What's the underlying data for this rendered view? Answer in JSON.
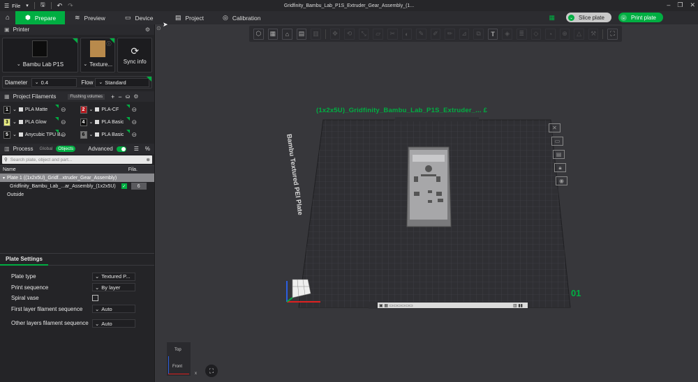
{
  "titlebar": {
    "file_menu": "File",
    "title": "Gridfinity_Bambu_Lab_P1S_Extruder_Gear_Assembly_(1..."
  },
  "tabs": [
    {
      "label": "Prepare",
      "icon": "cube-icon"
    },
    {
      "label": "Preview",
      "icon": "layers-icon"
    },
    {
      "label": "Device",
      "icon": "device-icon"
    },
    {
      "label": "Project",
      "icon": "project-icon"
    },
    {
      "label": "Calibration",
      "icon": "calibration-icon"
    }
  ],
  "actions": {
    "slice": "Slice plate",
    "print": "Print plate"
  },
  "printer": {
    "header": "Printer",
    "model": "Bambu Lab P1S",
    "plate": "Texture...",
    "sync": "Sync info",
    "diameter_label": "Diameter",
    "diameter_value": "0.4",
    "flow_label": "Flow",
    "flow_value": "Standard"
  },
  "filaments": {
    "header": "Project Filaments",
    "flushing": "Flushing volumes",
    "items": [
      {
        "num": "1",
        "name": "PLA Matte",
        "color": "#111111",
        "text_color": "#ffffff"
      },
      {
        "num": "2",
        "name": "PLA-CF",
        "color": "#b5191f",
        "text_color": "#ffffff"
      },
      {
        "num": "3",
        "name": "PLA Glow",
        "color": "#e9ed80",
        "text_color": "#000000"
      },
      {
        "num": "4",
        "name": "PLA Basic",
        "color": "#111111",
        "text_color": "#ffffff"
      },
      {
        "num": "5",
        "name": "Anycubic TPU B...",
        "color": "#111111",
        "text_color": "#ffffff"
      },
      {
        "num": "6",
        "name": "PLA Basic",
        "color": "#7a7a7a",
        "text_color": "#000000"
      }
    ]
  },
  "process": {
    "header": "Process",
    "global": "Global",
    "objects": "Objects",
    "advanced": "Advanced",
    "search_placeholder": "Search plate, object and part...",
    "col_name": "Name",
    "col_fila": "Fila.",
    "plate_row": "Plate 1 ((1x2x5U)_Gridf...xtruder_Gear_Assembly)",
    "object_row": "Gridfinity_Bambu_Lab_...ar_Assembly_(1x2x5U)",
    "object_fila": "6",
    "outside_row": "Outside"
  },
  "plate_settings": {
    "tab": "Plate Settings",
    "rows": [
      {
        "label": "Plate type",
        "value": "Textured P..."
      },
      {
        "label": "Print sequence",
        "value": "By layer"
      },
      {
        "label": "Spiral vase",
        "value": ""
      },
      {
        "label": "First layer filament sequence",
        "value": "Auto"
      },
      {
        "label": "Other layers filament sequence",
        "value": "Auto"
      }
    ]
  },
  "viewport": {
    "plate_name": "(1x2x5U)_Gridfinity_Bambu_Lab_P1S_Extruder_... £",
    "bed_text": "Bambu Textured PEI Plate",
    "plate_number": "01",
    "view_top": "Top",
    "view_front": "Front",
    "axis_x": "x"
  },
  "colors": {
    "accent": "#00ae42",
    "sidebar": "#242427",
    "viewport": "#37373b",
    "bed": "#2f2f33"
  }
}
